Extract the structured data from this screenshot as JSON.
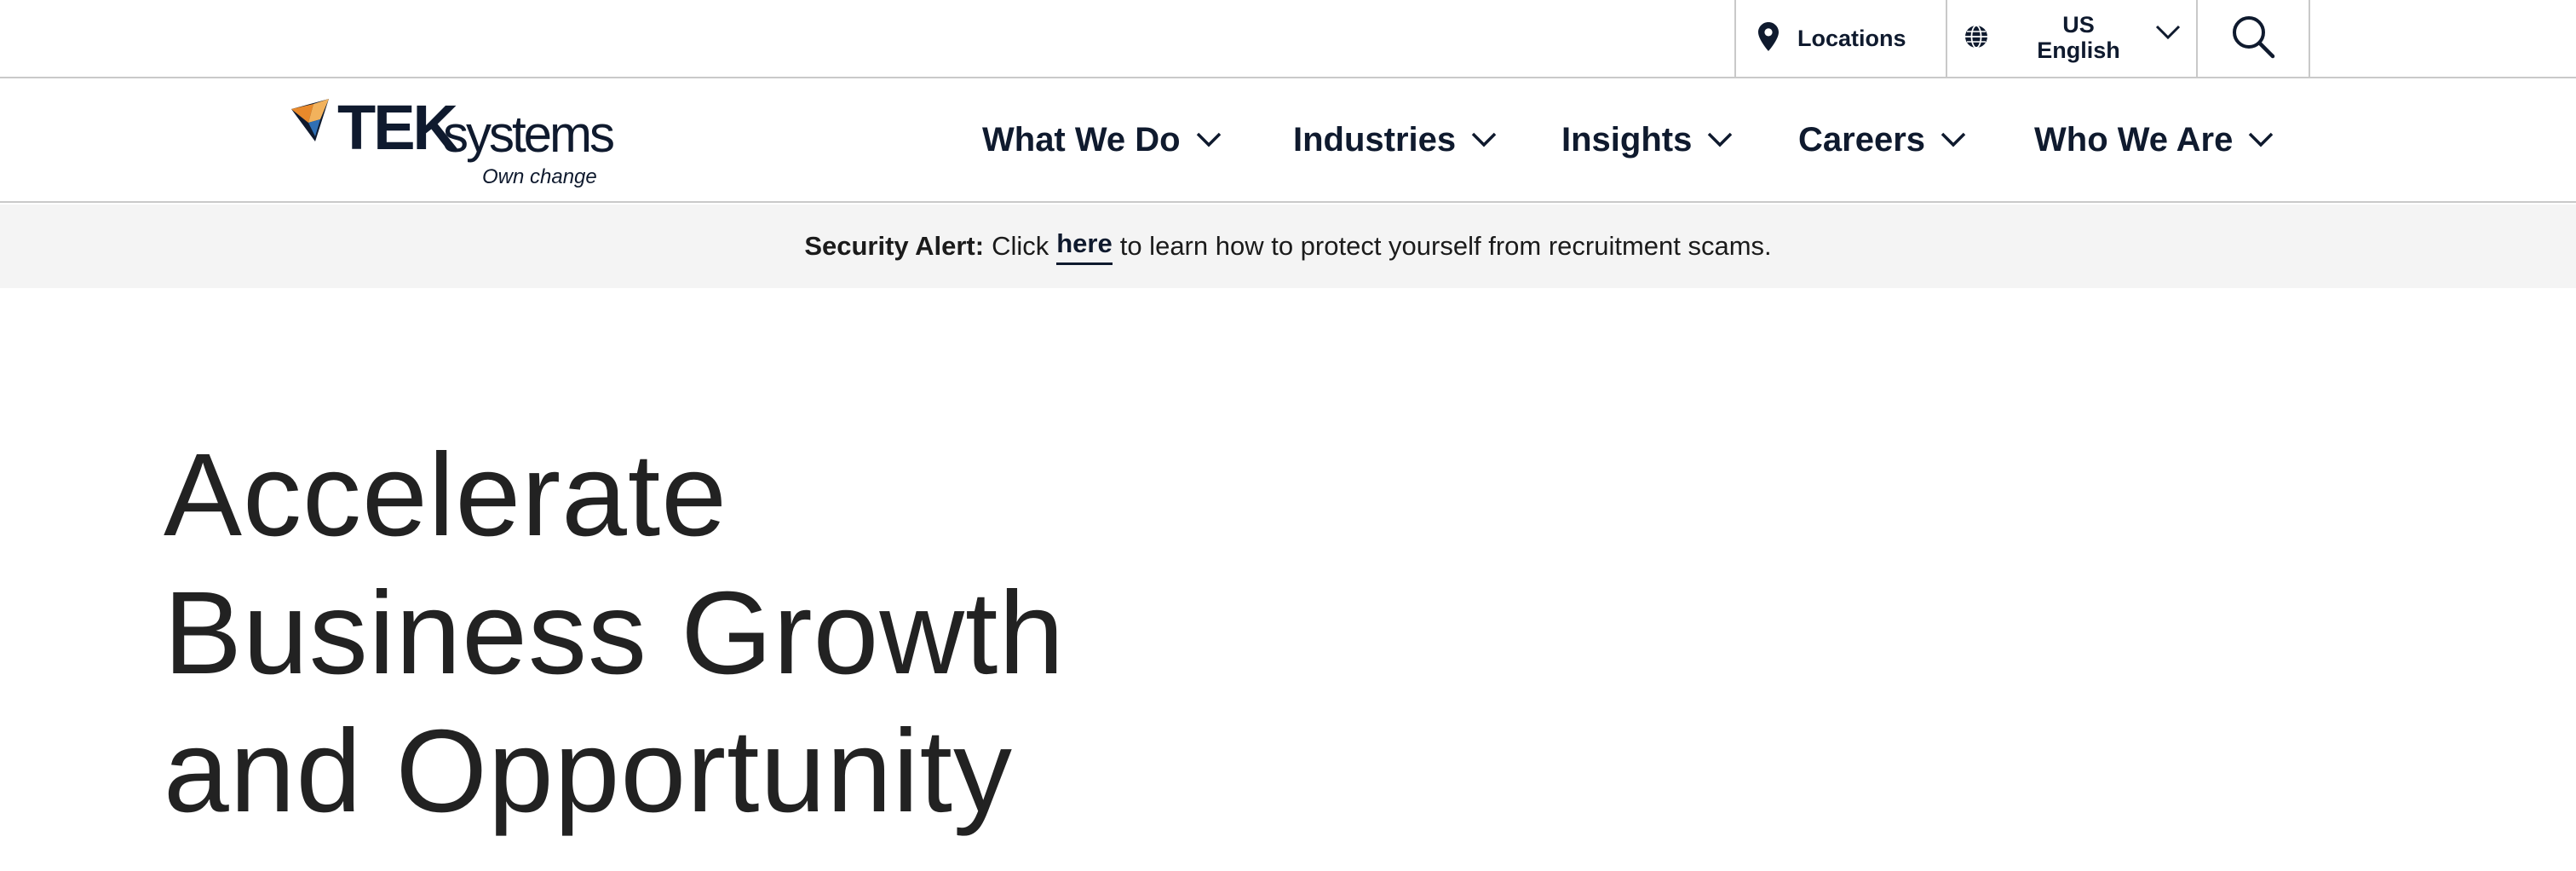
{
  "utility_bar": {
    "locations_label": "Locations",
    "language": {
      "region": "US",
      "language": "English"
    },
    "icons": [
      "map-pin-icon",
      "globe-icon",
      "chevron-down-icon",
      "search-icon"
    ]
  },
  "logo": {
    "brand_bold": "TEK",
    "brand_light": "systems",
    "tagline": "Own change",
    "colors": {
      "orange": "#e8892b",
      "blue": "#2f6fb5",
      "navy": "#0f1a2e"
    }
  },
  "nav": {
    "items": [
      {
        "label": "What We Do"
      },
      {
        "label": "Industries"
      },
      {
        "label": "Insights"
      },
      {
        "label": "Careers"
      },
      {
        "label": "Who We Are"
      }
    ]
  },
  "alert": {
    "strong": "Security Alert:",
    "prefix": "Click",
    "link": "here",
    "suffix": "to learn how to protect yourself from recruitment scams."
  },
  "hero": {
    "lines": [
      "Accelerate",
      "Business Growth",
      "and Opportunity"
    ]
  },
  "colors": {
    "text_navy": "#0f1a2e",
    "divider": "#c9c9c9",
    "alert_bg": "#f4f4f4",
    "hero_text": "#222222"
  }
}
